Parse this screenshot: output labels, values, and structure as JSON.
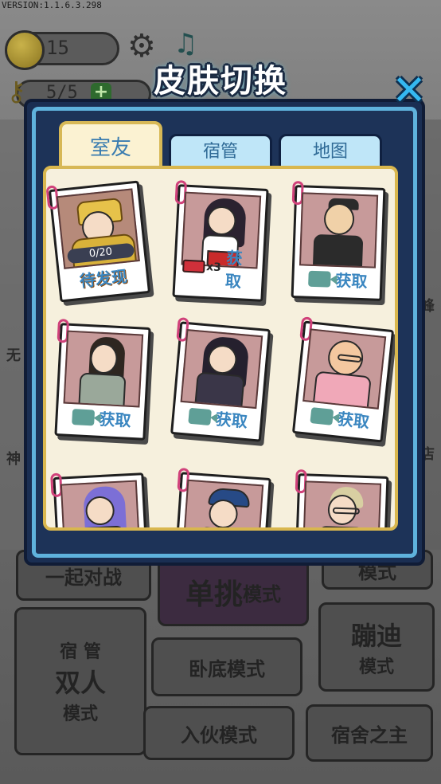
{
  "version": "VERSION:1.1.6.3.298",
  "topbar": {
    "coins": "15",
    "keys": "5/5",
    "keys_add": "+"
  },
  "side": {
    "left_1": "无",
    "left_2": "神",
    "right_1": "峰",
    "right_2": "店"
  },
  "modes": {
    "battle": "一起对战",
    "single_a": "单挑",
    "single_b": "模式",
    "right_top": "模式",
    "pair_top": "宿 管",
    "pair_a": "双人",
    "pair_b": "模式",
    "lie": "卧底模式",
    "join": "入伙模式",
    "disco_a": "蹦迪",
    "disco_b": "模式",
    "lord": "宿舍之主"
  },
  "modal": {
    "title": "皮肤切换",
    "close": "✕",
    "tabs": [
      {
        "label": "室友",
        "active": true
      },
      {
        "label": "宿管",
        "active": false
      },
      {
        "label": "地图",
        "active": false
      }
    ],
    "cards": [
      {
        "name": "golden-armor-skin",
        "progress": "0/20",
        "progress_fraction": 0,
        "status": "待发现"
      },
      {
        "name": "shrine-maiden-skin",
        "cost_icon": "ticket-icon",
        "cost_count": "x3",
        "action": "获取"
      },
      {
        "name": "black-shirt-guy-skin",
        "cost_icon": "video-icon",
        "action": "获取"
      },
      {
        "name": "robed-swordsman-skin",
        "cost_icon": "video-icon",
        "action": "获取"
      },
      {
        "name": "gothic-girl-skin",
        "cost_icon": "video-icon",
        "action": "获取"
      },
      {
        "name": "chubby-glasses-guy-skin",
        "cost_icon": "video-icon",
        "action": "获取"
      },
      {
        "name": "purple-hair-girl-skin"
      },
      {
        "name": "cap-boy-skin"
      },
      {
        "name": "glasses-blond-skin"
      }
    ]
  }
}
